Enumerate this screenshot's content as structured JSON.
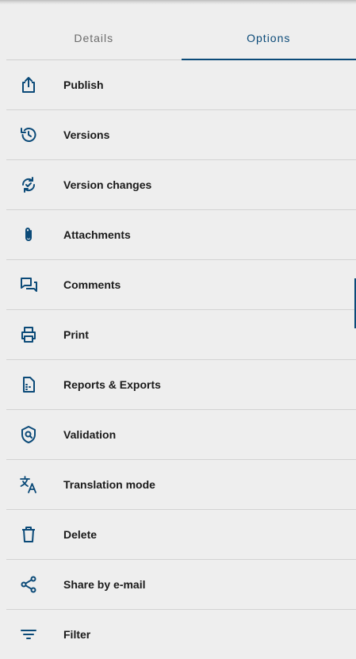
{
  "tabs": {
    "details": "Details",
    "options": "Options"
  },
  "accent_color": "#0b4a78",
  "menu": [
    {
      "label": "Publish",
      "icon": "publish-icon"
    },
    {
      "label": "Versions",
      "icon": "history-icon"
    },
    {
      "label": "Version changes",
      "icon": "sync-check-icon"
    },
    {
      "label": "Attachments",
      "icon": "paperclip-icon"
    },
    {
      "label": "Comments",
      "icon": "comments-icon"
    },
    {
      "label": "Print",
      "icon": "printer-icon"
    },
    {
      "label": "Reports & Exports",
      "icon": "document-report-icon"
    },
    {
      "label": "Validation",
      "icon": "shield-search-icon"
    },
    {
      "label": "Translation mode",
      "icon": "translate-icon"
    },
    {
      "label": "Delete",
      "icon": "trash-icon"
    },
    {
      "label": "Share by e-mail",
      "icon": "share-icon"
    },
    {
      "label": "Filter",
      "icon": "filter-icon"
    }
  ]
}
